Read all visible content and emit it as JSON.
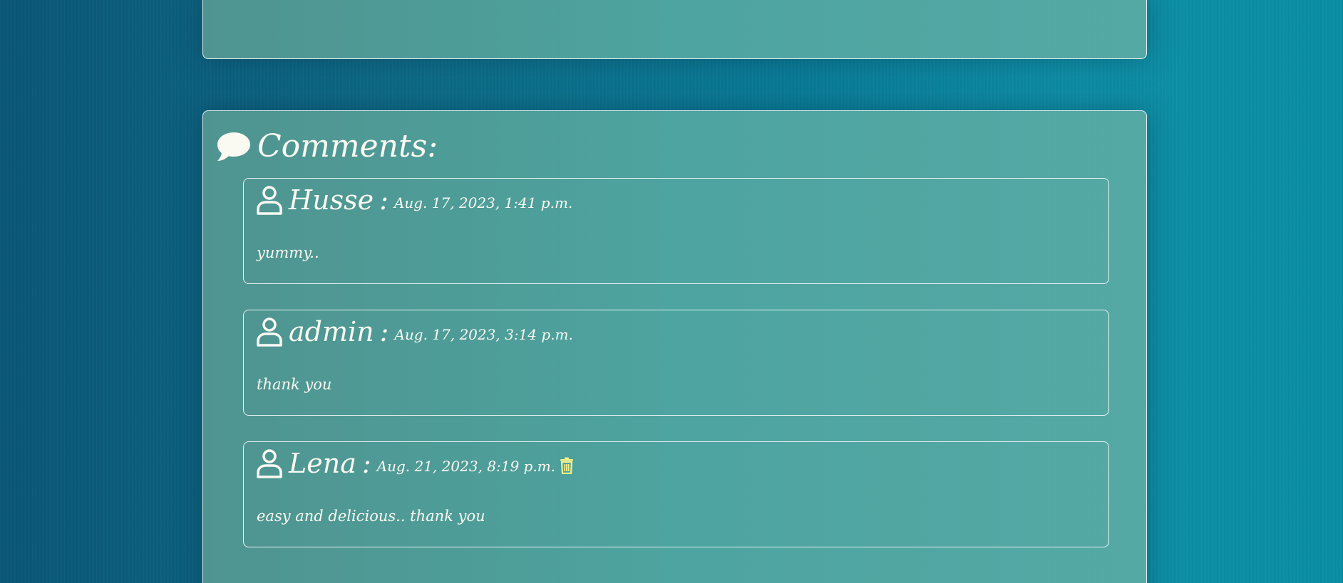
{
  "comments_section": {
    "heading": "Comments:",
    "heading_icon": "speech-bubble-icon",
    "items": [
      {
        "author": "Husse",
        "separator": ":",
        "date": "Aug. 17, 2023, 1:41 p.m.",
        "body": "yummy..",
        "can_delete": false
      },
      {
        "author": "admin",
        "separator": ":",
        "date": "Aug. 17, 2023, 3:14 p.m.",
        "body": "thank you",
        "can_delete": false
      },
      {
        "author": "Lena",
        "separator": ":",
        "date": "Aug. 21, 2023, 8:19 p.m.",
        "body": "easy and delicious.. thank you",
        "can_delete": true
      }
    ]
  },
  "colors": {
    "text": "#fbfaf2",
    "delete_icon": "#f3ef8a",
    "panel_border": "#ffffff"
  }
}
